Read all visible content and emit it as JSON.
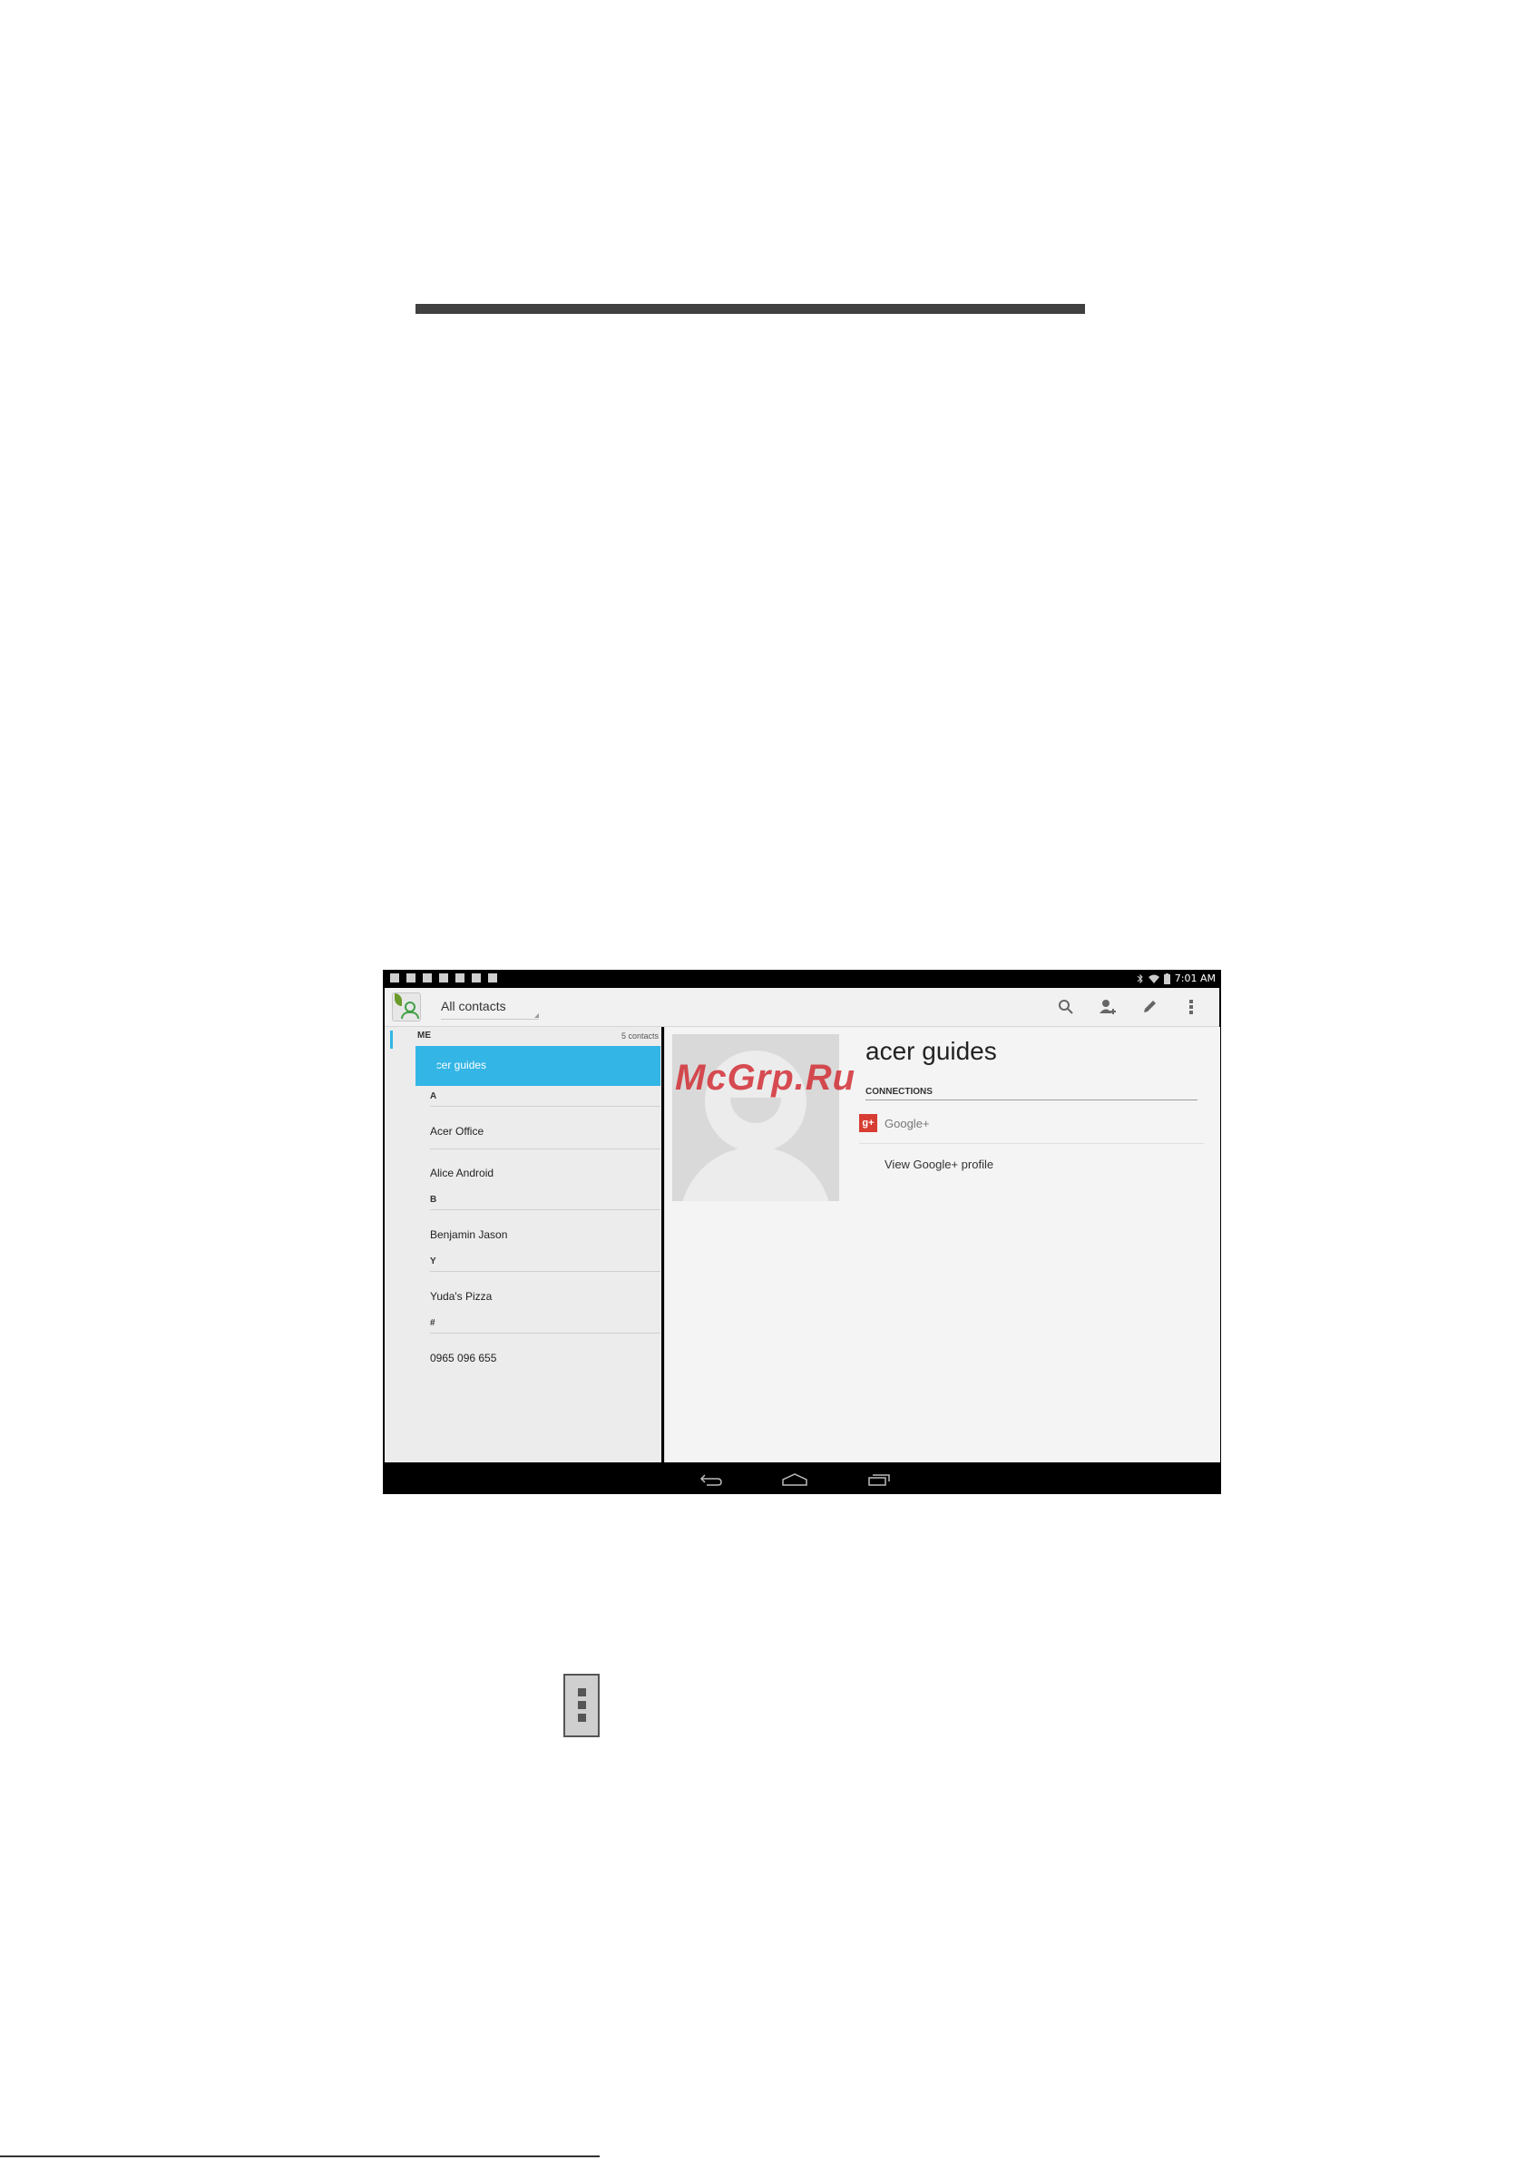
{
  "status_bar": {
    "time": "7:01 AM"
  },
  "action_bar": {
    "filter_label": "All contacts"
  },
  "contact_list": {
    "me_label": "ME",
    "contact_count": "5 contacts",
    "selected": "acer guides",
    "sections": [
      {
        "letter": "A",
        "contacts": [
          "Acer Office",
          "Alice Android"
        ]
      },
      {
        "letter": "B",
        "contacts": [
          "Benjamin Jason"
        ]
      },
      {
        "letter": "Y",
        "contacts": [
          "Yuda's Pizza"
        ]
      },
      {
        "letter": "#",
        "contacts": [
          "0965 096 655"
        ]
      }
    ]
  },
  "detail": {
    "name": "acer guides",
    "connections_label": "CONNECTIONS",
    "service": "Google+",
    "service_icon": "g+",
    "view_profile": "View Google+ profile"
  },
  "watermark": "McGrp.Ru",
  "colors": {
    "accent": "#33b5e5",
    "gplus": "#d73d32",
    "watermark": "#d1242b"
  }
}
